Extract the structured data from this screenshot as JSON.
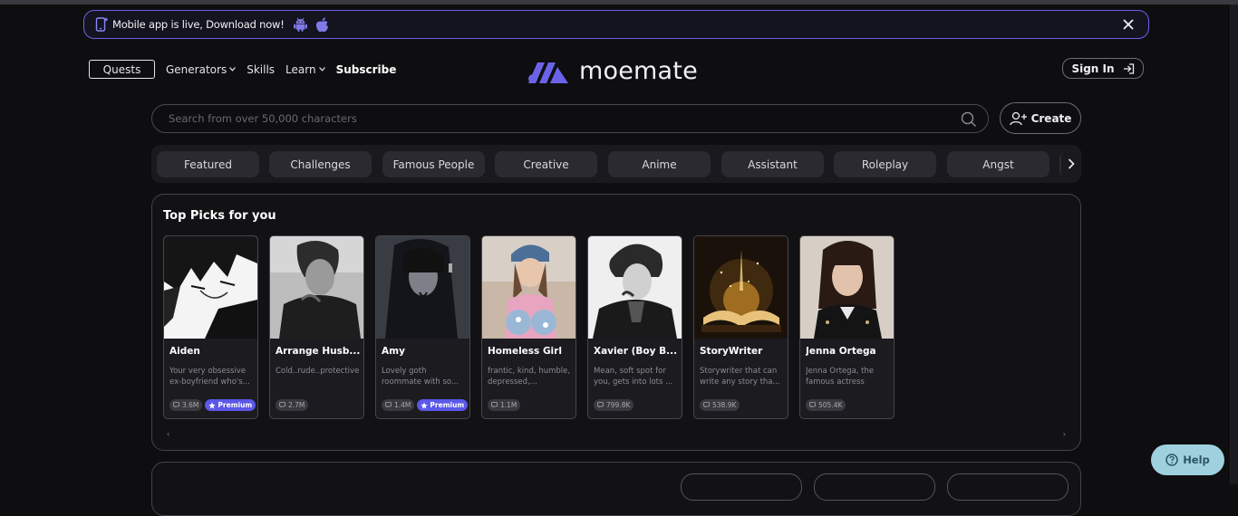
{
  "banner": {
    "text": "Mobile app is live, Download now!"
  },
  "nav": {
    "quests": "Quests",
    "generators": "Generators",
    "skills": "Skills",
    "learn": "Learn",
    "subscribe": "Subscribe"
  },
  "logo": {
    "name": "moemate"
  },
  "header": {
    "signin": "Sign In"
  },
  "search": {
    "placeholder": "Search from over 50,000 characters",
    "create": "Create"
  },
  "categories": [
    "Featured",
    "Challenges",
    "Famous People",
    "Creative",
    "Anime",
    "Assistant",
    "Roleplay",
    "Angst"
  ],
  "top_picks": {
    "title": "Top Picks for you",
    "cards": [
      {
        "name": "Aiden",
        "desc": "Your very obsessive ex-boyfriend who's...",
        "count": "3.6M",
        "premium": "Premium"
      },
      {
        "name": "Arrange Husb...",
        "desc": "Cold..rude..protective",
        "count": "2.7M"
      },
      {
        "name": "Amy",
        "desc": "Lovely goth roommate with so...",
        "count": "1.4M",
        "premium": "Premium"
      },
      {
        "name": "Homeless Girl",
        "desc": "frantic, kind, humble, depressed,...",
        "count": "1.1M"
      },
      {
        "name": "Xavier (Boy B...",
        "desc": "Mean, soft spot for you, gets into lots ...",
        "count": "799.8K"
      },
      {
        "name": "StoryWriter",
        "desc": "Storywriter that can write any story tha...",
        "count": "538.9K"
      },
      {
        "name": "Jenna Ortega",
        "desc": "Jenna Ortega, the famous actress",
        "count": "505.4K"
      }
    ]
  },
  "help": {
    "label": "Help"
  },
  "colors": {
    "accent": "#5b57e8",
    "banner_border": "#6a63e8",
    "help_bg": "#9fd0de",
    "background": "#0e0d10"
  }
}
